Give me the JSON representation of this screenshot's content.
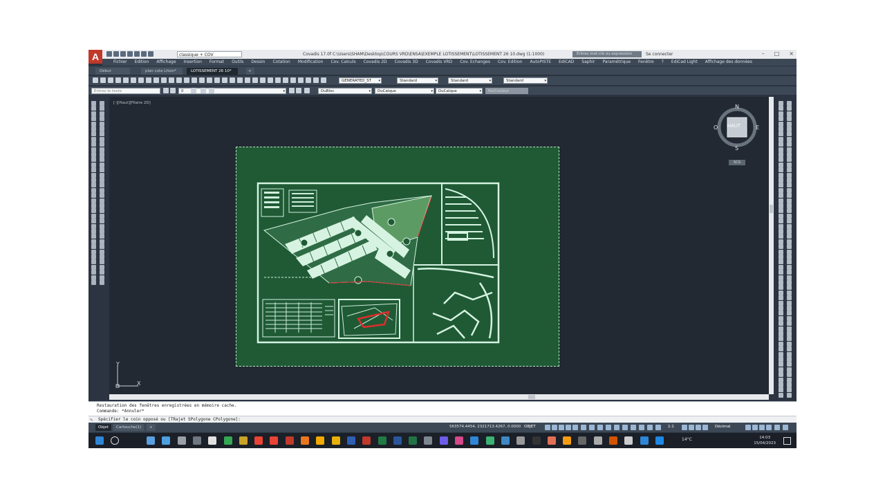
{
  "app": {
    "title": "Covadis 17.0f    C:\\Users\\SHAM\\Desktop\\COURS VRD\\ENSA\\EXEMPLE LOTISSEMENT\\LOTISSEMENT 26 10.dwg (1:1000)",
    "workspace": "classique + COV",
    "search_placeholder": "Entrez mot-clé ou expression",
    "sign_in": "Se connecter"
  },
  "menu": [
    "Fichier",
    "Edition",
    "Affichage",
    "Insertion",
    "Format",
    "Outils",
    "Dessin",
    "Cotation",
    "Modification",
    "Cov. Calculs",
    "Covadis 2D",
    "Covadis 3D",
    "Covadis VRD",
    "Cov. Echanges",
    "Cov. Edition",
    "AutoPISTE",
    "EdiCAD",
    "Saphir",
    "Paramétrique",
    "Fenêtre",
    "?",
    "EdiCad Light",
    "Affichage des données"
  ],
  "doc_tabs": [
    "Début",
    "plan cote Lhion*",
    "LOTISSEMENT 26 10*"
  ],
  "toolbar": {
    "textstyle": "GENERATED_ST",
    "dimstyle": "Standard",
    "tablestyle": "Standard",
    "mleaderstyle": "Standard",
    "find_placeholder": "Entrez le texte",
    "layer": "0",
    "color": "DuBloc",
    "linetype": "DuCalque",
    "lineweight": "DuCalque",
    "plotstyle": "ParCouleur"
  },
  "viewport_label": "[-][Haut][Filaire 2D]",
  "viewcube": {
    "top": "HAUT",
    "n": "N",
    "s": "S",
    "e": "E",
    "w": "O",
    "ucs": "SCG"
  },
  "ucs": {
    "x": "X",
    "y": "Y"
  },
  "command": {
    "history": [
      "Restauration des fenêtres enregistrées en mémoire cache.",
      "Commande: *Annuler*"
    ],
    "prompt": "Spécifier le coin opposé ou [TRajet SPolygone CPolygone]:"
  },
  "layout_tabs": [
    "Objet",
    "Cartouche(1)",
    "+"
  ],
  "status": {
    "coords": "563574.4454, 2321713.4267, 0.0000",
    "space": "OBJET",
    "scale": "1:1",
    "units": "Décimal"
  },
  "taskbar": {
    "temperature": "14°C",
    "time": "14:03",
    "date": "15/04/2023"
  },
  "colors": {
    "sheet": "#1f5a35",
    "lines": "#cfeedd",
    "red": "#e02c2c"
  }
}
